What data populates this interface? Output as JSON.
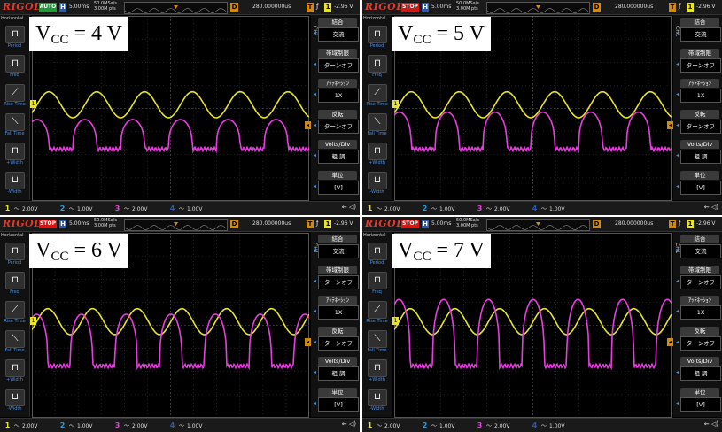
{
  "common": {
    "logo": "RIGOL",
    "h_badge": "H",
    "time_div": "5.00ms",
    "sample_rate": "50.0MSa/s",
    "points": "3.00M pts",
    "d_badge": "D",
    "delay": "280.000000us",
    "t_badge": "T",
    "trigger_symbol": "ƒ",
    "trigger_channel": "1",
    "trigger_level": "-2.96 V",
    "left_header": "Horizontal",
    "measure_items": [
      "Period",
      "Freq",
      "Rise Time",
      "Fall Time",
      "+Width",
      "-Width"
    ],
    "ch_label": "CH1",
    "menu": [
      {
        "label": "結合",
        "value": "交流"
      },
      {
        "label": "帯域制限",
        "value": "ターンオフ"
      },
      {
        "label": "ｱｯﾃﾈｰｼｮﾝ",
        "value": "1X"
      },
      {
        "label": "反転",
        "value": "ターンオフ"
      },
      {
        "label": "Volts/Div",
        "value": "粗 調"
      },
      {
        "label": "単位",
        "value": "[V]"
      }
    ],
    "channels": [
      {
        "num": "1",
        "value": "2.00V",
        "color": "#e8e42a"
      },
      {
        "num": "2",
        "value": "1.00V",
        "color": "#2a9de0"
      },
      {
        "num": "3",
        "value": "2.00V",
        "color": "#e83ee0"
      },
      {
        "num": "4",
        "value": "1.00V",
        "color": "#2d5aa8"
      }
    ],
    "usb_icon": "usb-icon",
    "speaker_icon": "speaker-icon",
    "colors": {
      "ch1": "#e8e42a",
      "ch3": "#e83ee0",
      "grid": "#3c3c3c",
      "stop": "#d01818",
      "auto": "#1f9a3a"
    }
  },
  "panels": [
    {
      "vcc_v": "V",
      "vcc_sub": "CC",
      "vcc_rest": " = 4 V",
      "state": "AUTO",
      "signal": {
        "yellow_amp": 0.07,
        "magenta_top": 0.56,
        "magenta_floor": 0.72,
        "clip": 0.6,
        "cycles": 5.8
      }
    },
    {
      "vcc_v": "V",
      "vcc_sub": "CC",
      "vcc_rest": " = 5 V",
      "state": "STOP",
      "signal": {
        "yellow_amp": 0.07,
        "magenta_top": 0.52,
        "magenta_floor": 0.72,
        "clip": 0.55,
        "cycles": 5.8
      }
    },
    {
      "vcc_v": "V",
      "vcc_sub": "CC",
      "vcc_rest": " = 6 V",
      "state": "STOP",
      "signal": {
        "yellow_amp": 0.07,
        "magenta_top": 0.44,
        "magenta_floor": 0.72,
        "clip": 0.45,
        "cycles": 6.2
      }
    },
    {
      "vcc_v": "V",
      "vcc_sub": "CC",
      "vcc_rest": " = 7 V",
      "state": "STOP",
      "signal": {
        "yellow_amp": 0.07,
        "magenta_top": 0.36,
        "magenta_floor": 0.72,
        "clip": 0.38,
        "cycles": 6.2
      }
    }
  ]
}
